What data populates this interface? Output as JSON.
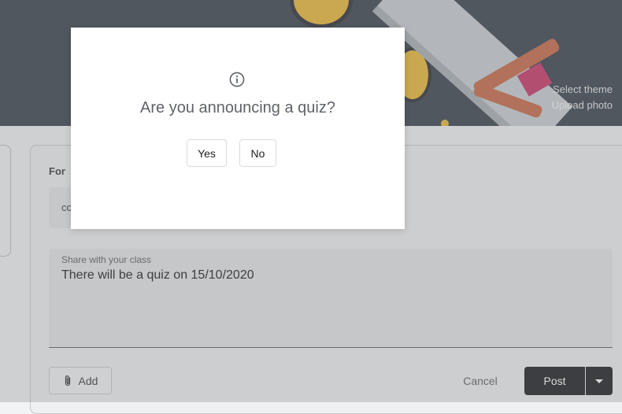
{
  "banner": {
    "select_theme": "Select theme",
    "upload_photo": "Upload photo"
  },
  "form": {
    "for_label": "For",
    "class_value_visible": "co",
    "share_label": "Share with your class",
    "share_text": "There will be a quiz on 15/10/2020",
    "add_label": "Add",
    "cancel_label": "Cancel",
    "post_label": "Post"
  },
  "dialog": {
    "title": "Are you announcing a quiz?",
    "yes_label": "Yes",
    "no_label": "No",
    "icon": "info-icon"
  },
  "colors": {
    "banner_bg": "#3c4650",
    "post_button": "#1f2226",
    "medal_gold": "#e9b93a",
    "ribbon": "#c86a4a"
  }
}
